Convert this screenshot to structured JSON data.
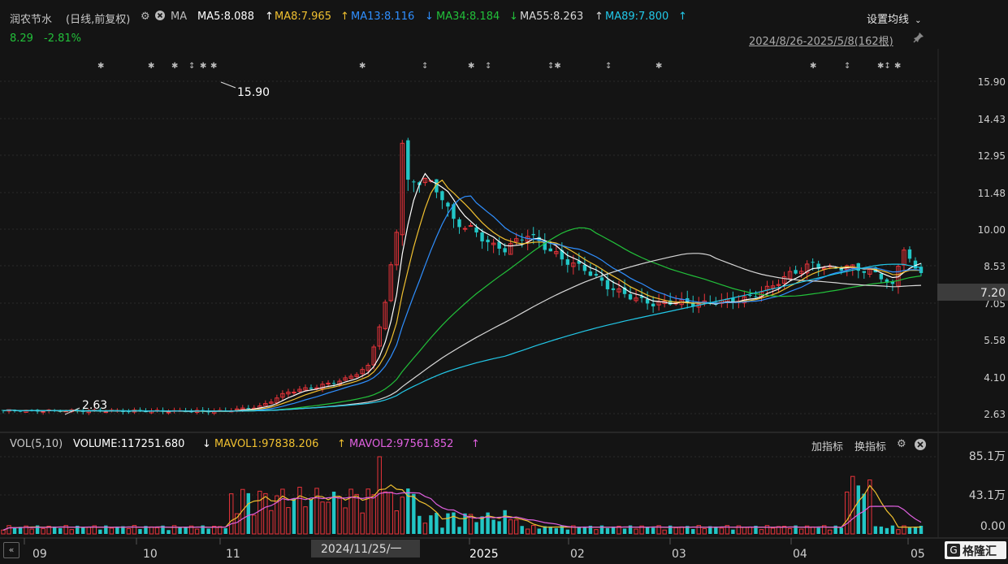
{
  "header": {
    "stock_name": "润农节水",
    "period_info": "(日线,前复权)",
    "ma_label": "MA",
    "settings_label": "设置均线",
    "ma_items": [
      {
        "label": "MA5:8.088",
        "arrow": "↑",
        "color": "#ffffff"
      },
      {
        "label": "MA8:7.965",
        "arrow": "↑",
        "color": "#f0c030"
      },
      {
        "label": "MA13:8.116",
        "arrow": "↓",
        "color": "#2f8fff"
      },
      {
        "label": "MA34:8.184",
        "arrow": "↓",
        "color": "#22c03a"
      },
      {
        "label": "MA55:8.263",
        "arrow": "↑",
        "color": "#d8d8d8"
      },
      {
        "label": "MA89:7.800",
        "arrow": "↑",
        "color": "#22c8e8"
      }
    ]
  },
  "quote": {
    "price": "8.29",
    "change": "-2.81%"
  },
  "range_info": "2024/8/26-2025/5/8(162根)",
  "price_axis": [
    "15.90",
    "14.43",
    "12.95",
    "11.48",
    "10.00",
    "8.53",
    "7.05",
    "5.58",
    "4.10",
    "2.63"
  ],
  "current_price_tag": "7.20",
  "annotations": {
    "high": "15.90",
    "low": "2.63"
  },
  "volume": {
    "title": "VOL(5,10)",
    "volume_label": "VOLUME:117251.680",
    "volume_arrow": "↓",
    "mavol1_label": "MAVOL1:97838.206",
    "mavol1_arrow": "↑",
    "mavol2_label": "MAVOL2:97561.852",
    "mavol2_arrow": "↑",
    "add_indicator": "加指标",
    "switch_indicator": "换指标",
    "axis": [
      "85.1万",
      "43.1万",
      "0.00"
    ]
  },
  "time_axis": [
    "09",
    "10",
    "11",
    "2025",
    "02",
    "03",
    "04",
    "05"
  ],
  "crosshair_date": "2024/11/25/一",
  "logo_text": "格隆汇",
  "colors": {
    "up": "#e8333a",
    "down": "#22c6c6",
    "bg": "#141414",
    "grid": "#2a2a2a"
  },
  "chart_data": {
    "type": "candlestick",
    "ylim": [
      2.63,
      15.9
    ],
    "ma_series": [
      "MA5",
      "MA8",
      "MA13",
      "MA34",
      "MA55",
      "MA89"
    ],
    "volume_ylim": [
      0,
      851000
    ]
  }
}
